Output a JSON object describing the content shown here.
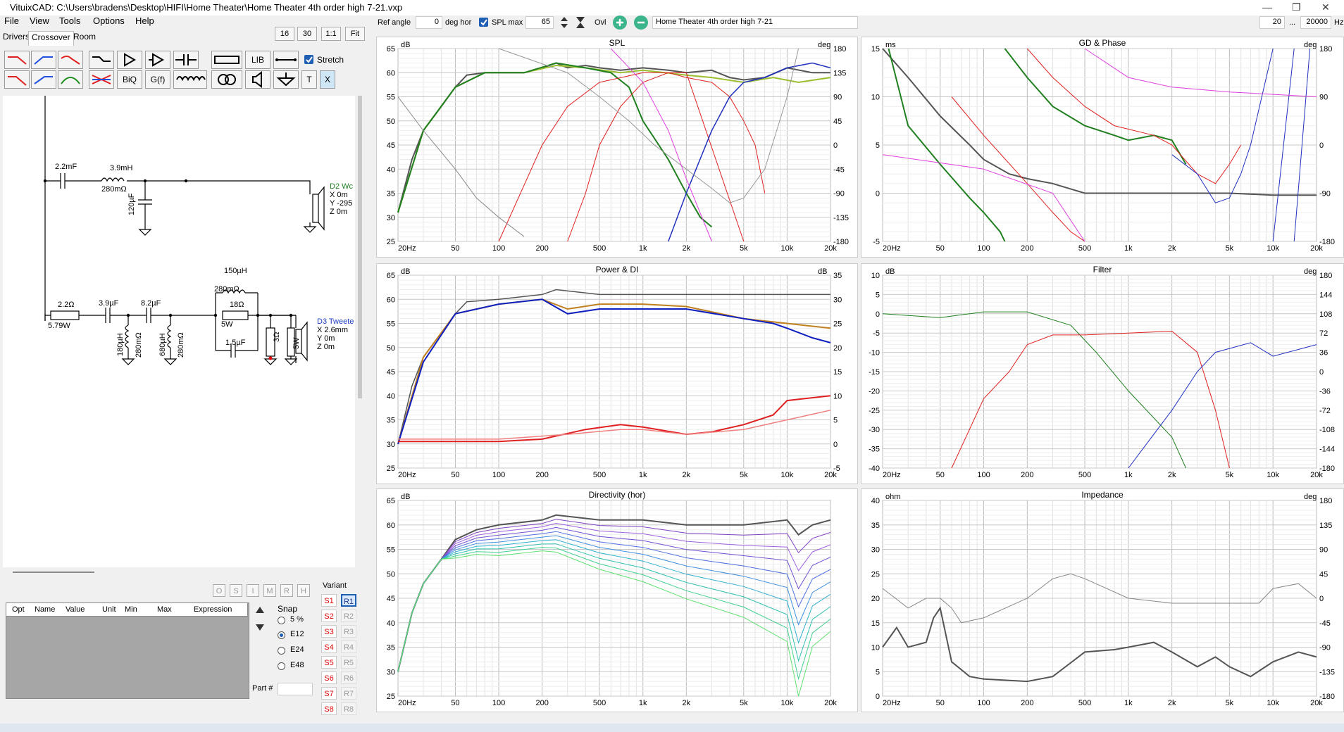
{
  "window": {
    "title": "VituixCAD: C:\\Users\\bradens\\Desktop\\HIFI\\Home Theater\\Home Theater 4th order high 7-21.vxp"
  },
  "menu": [
    "File",
    "View",
    "Tools",
    "Options",
    "Help"
  ],
  "tabs": [
    "Drivers",
    "Crossover",
    "Room"
  ],
  "zoom_buttons": [
    "16",
    "30",
    "1:1",
    "Fit"
  ],
  "tools": {
    "lib": "LIB",
    "biq": "BiQ",
    "gf": "G(f)",
    "t": "T",
    "x": "X",
    "stretch": "Stretch"
  },
  "top": {
    "ref_angle_label": "Ref angle",
    "ref_angle_value": "0",
    "deg_hor": "deg hor",
    "spl_max_label": "SPL max",
    "spl_max_value": "65",
    "ovl": "Ovl",
    "project_name": "Home Theater 4th order high 7-21",
    "freq_min": "20",
    "ellipsis": "...",
    "freq_max": "20000",
    "hz": "Hz"
  },
  "schematic": {
    "c1": "2.2mF",
    "l1": "3.9mH",
    "l1r": "280mΩ",
    "c2": "120µF",
    "woofer_name": "D2 Wc",
    "woofer_x": "X 0m",
    "woofer_y": "Y -295",
    "woofer_z": "Z 0m",
    "r1": "2.2Ω",
    "r1w": "5.79W",
    "c3": "3.9µF",
    "c4": "8.2µF",
    "l2": "180µH",
    "l2r": "280mΩ",
    "l3": "680µH",
    "l3r": "280mΩ",
    "l4": "150µH",
    "l4r": "280mΩ",
    "r2": "18Ω",
    "r2w": "5W",
    "c5": "1.5µF",
    "r3": "3Ω",
    "r3w": "5W",
    "tweeter_name": "D3 Tweete",
    "tweeter_x": "X 2.6mm",
    "tweeter_y": "Y 0m",
    "tweeter_z": "Z 0m"
  },
  "params": {
    "headers": [
      "Opt",
      "Name",
      "Value",
      "Unit",
      "Min",
      "Max",
      "Expression"
    ],
    "buttons": [
      "O",
      "S",
      "I",
      "M",
      "R",
      "H"
    ],
    "part_label": "Part #"
  },
  "snap": {
    "title": "Snap",
    "options": [
      "5 %",
      "E12",
      "E24",
      "E48"
    ],
    "selected": "E12"
  },
  "variant": {
    "title": "Variant",
    "s": [
      "S1",
      "S2",
      "S3",
      "S4",
      "S5",
      "S6",
      "S7",
      "S8"
    ],
    "r": [
      "R1",
      "R2",
      "R3",
      "R4",
      "R5",
      "R6",
      "R7",
      "R8"
    ]
  },
  "freq_ticks": [
    "20Hz",
    "50",
    "100",
    "200",
    "500",
    "1k",
    "2k",
    "5k",
    "10k",
    "20k"
  ],
  "graphs": {
    "spl": {
      "title": "SPL",
      "left_unit": "dB",
      "right_unit": "deg",
      "left_ticks": [
        "65",
        "60",
        "55",
        "50",
        "45",
        "40",
        "35",
        "30",
        "25"
      ],
      "right_ticks": [
        "180",
        "135",
        "90",
        "45",
        "0",
        "-45",
        "-90",
        "-135",
        "-180"
      ]
    },
    "gd": {
      "title": "GD & Phase",
      "left_unit": "ms",
      "right_unit": "deg",
      "left_ticks": [
        "15",
        "10",
        "5",
        "0",
        "-5"
      ],
      "right_ticks": [
        "180",
        "90",
        "0",
        "-90",
        "-180"
      ]
    },
    "power": {
      "title": "Power & DI",
      "left_unit": "dB",
      "right_unit": "dB",
      "left_ticks": [
        "65",
        "60",
        "55",
        "50",
        "45",
        "40",
        "35",
        "30",
        "25"
      ],
      "right_ticks": [
        "35",
        "30",
        "25",
        "20",
        "15",
        "10",
        "5",
        "0",
        "-5"
      ]
    },
    "filter": {
      "title": "Filter",
      "left_unit": "dB",
      "right_unit": "deg",
      "left_ticks": [
        "10",
        "5",
        "0",
        "-5",
        "-10",
        "-15",
        "-20",
        "-25",
        "-30",
        "-35",
        "-40"
      ],
      "right_ticks": [
        "180",
        "144",
        "108",
        "72",
        "36",
        "0",
        "-36",
        "-72",
        "-108",
        "-144",
        "-180"
      ]
    },
    "directivity": {
      "title": "Directivity (hor)",
      "left_unit": "dB",
      "left_ticks": [
        "65",
        "60",
        "55",
        "50",
        "45",
        "40",
        "35",
        "30",
        "25"
      ]
    },
    "impedance": {
      "title": "Impedance",
      "left_unit": "ohm",
      "right_unit": "deg",
      "left_ticks": [
        "40",
        "35",
        "30",
        "25",
        "20",
        "15",
        "10",
        "5",
        "0"
      ],
      "right_ticks": [
        "180",
        "135",
        "90",
        "45",
        "0",
        "-45",
        "-90",
        "-135",
        "-180"
      ]
    }
  },
  "chart_data": [
    {
      "type": "line",
      "title": "SPL",
      "ylim": [
        25,
        65
      ],
      "series": [
        {
          "x": [
            20,
            30,
            50,
            80,
            100,
            200,
            300,
            500,
            1000,
            2000,
            5000,
            10000,
            20000
          ],
          "values": [
            31,
            48,
            59,
            60,
            60,
            61,
            61,
            60,
            61,
            60,
            58,
            59,
            60
          ]
        },
        {
          "x": [
            100,
            200,
            300,
            500,
            1000,
            2000,
            5000
          ],
          "values": [
            25,
            45,
            53,
            58,
            60,
            60,
            25
          ]
        },
        {
          "x": [
            1500,
            2000,
            3000,
            5000,
            10000,
            20000
          ],
          "values": [
            25,
            35,
            50,
            58,
            60,
            62
          ]
        }
      ]
    },
    {
      "type": "line",
      "title": "Power & DI",
      "ylim": [
        25,
        65
      ],
      "series": [
        {
          "x": [
            20,
            30,
            50,
            100,
            200,
            500,
            1000,
            2000,
            5000,
            10000,
            20000
          ],
          "values": [
            30,
            47,
            58,
            59,
            60,
            58,
            58,
            58,
            56,
            54,
            51
          ]
        },
        {
          "x": [
            20,
            50,
            100,
            200,
            500,
            1000,
            2000,
            5000,
            10000,
            20000
          ],
          "values": [
            31,
            31,
            31,
            31,
            33,
            33,
            32,
            33,
            35,
            40
          ]
        }
      ]
    },
    {
      "type": "line",
      "title": "Impedance",
      "ylim": [
        0,
        40
      ],
      "series": [
        {
          "x": [
            20,
            30,
            40,
            50,
            60,
            100,
            200,
            500,
            1000,
            2000,
            5000,
            10000,
            20000
          ],
          "values": [
            10,
            14,
            10,
            18,
            7,
            4,
            3,
            9,
            10,
            7,
            4,
            9,
            8
          ]
        }
      ]
    }
  ]
}
